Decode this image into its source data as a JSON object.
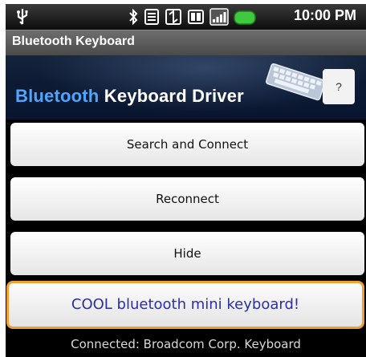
{
  "status_bar": {
    "time": "10:00 PM",
    "icons": [
      "usb-icon",
      "bluetooth-icon",
      "wifi-icon",
      "sync-icon",
      "sd-card-icon",
      "signal-icon",
      "battery-icon"
    ],
    "battery_color": "#3ec93e"
  },
  "app": {
    "title": "Bluetooth Keyboard"
  },
  "banner": {
    "title_part1": "Bluetooth",
    "title_part2": " Keyboard Driver",
    "help_label": "?"
  },
  "actions": {
    "search_connect": "Search and Connect",
    "reconnect": "Reconnect",
    "hide": "Hide"
  },
  "ad": {
    "text": "COOL bluetooth mini keyboard!"
  },
  "footer": {
    "status": "Connected: Broadcom Corp.   Keyboard"
  }
}
